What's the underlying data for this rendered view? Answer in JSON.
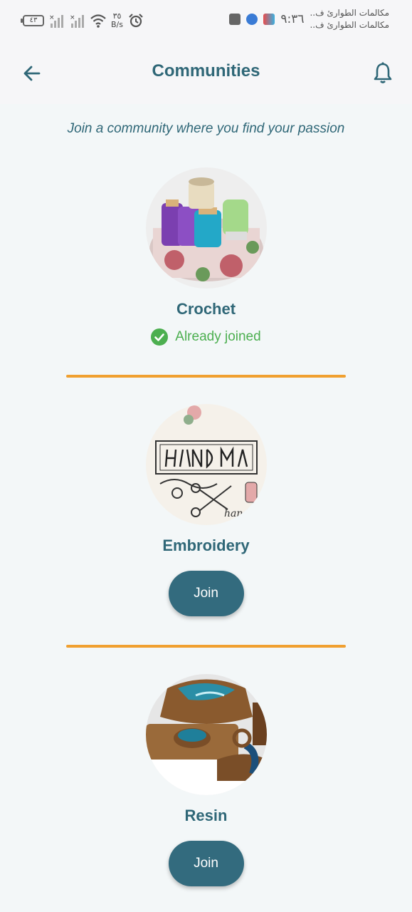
{
  "status_bar": {
    "battery": "٤٣",
    "net_speed_value": "٣٥",
    "net_speed_unit": "B/s",
    "time": "٩:٣٦",
    "notif_line1": "مكالمات الطوارئ ف..",
    "notif_line2": "مكالمات الطوارئ ف.."
  },
  "header": {
    "title": "Communities"
  },
  "tagline": "Join a community where you find your passion",
  "communities": [
    {
      "name": "Crochet",
      "status": "Already joined",
      "image": "spools-of-thread"
    },
    {
      "name": "Embroidery",
      "button": "Join",
      "image": "handmade-clip-art"
    },
    {
      "name": "Resin",
      "button": "Join",
      "image": "resin-wood-trays"
    }
  ],
  "colors": {
    "primary": "#2f6777",
    "button": "#336b7e",
    "divider": "#f0a030",
    "joined": "#4caf50",
    "background": "#f3f7f8"
  }
}
